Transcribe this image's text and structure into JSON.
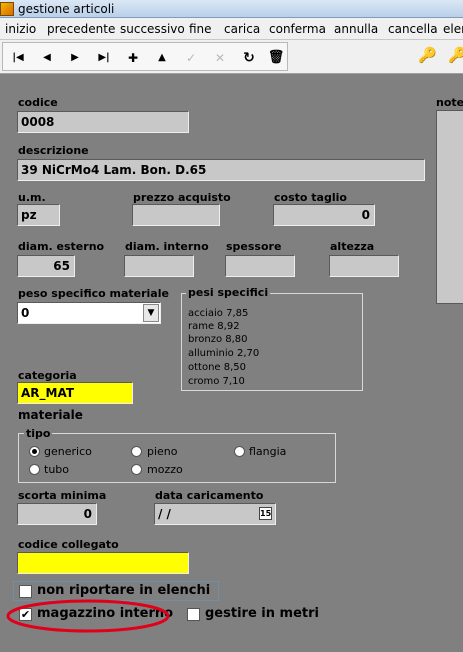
{
  "window": {
    "title": "gestione articoli"
  },
  "menu": [
    "inizio",
    "precedente",
    "successivo",
    "fine",
    "carica",
    "conferma",
    "annulla",
    "cancella",
    "elen"
  ],
  "toolbar": {
    "first": "|◀",
    "prev": "◀",
    "next": "▶",
    "last": "▶|",
    "add": "✚",
    "up": "▲",
    "check": "✓",
    "cancel": "✕",
    "refresh": "↻",
    "trash": "🗑"
  },
  "form": {
    "codice": {
      "label": "codice",
      "value": "0008"
    },
    "descrizione": {
      "label": "descrizione",
      "value": "39 NiCrMo4 Lam. Bon. D.65"
    },
    "um": {
      "label": "u.m.",
      "value": "pz"
    },
    "prezzo_acquisto": {
      "label": "prezzo acquisto",
      "value": ""
    },
    "costo_taglio": {
      "label": "costo taglio",
      "value": "0"
    },
    "diam_esterno": {
      "label": "diam. esterno",
      "value": "65"
    },
    "diam_interno": {
      "label": "diam. interno",
      "value": ""
    },
    "spessore": {
      "label": "spessore",
      "value": ""
    },
    "altezza": {
      "label": "altezza",
      "value": ""
    },
    "peso_specifico": {
      "label": "peso specifico materiale",
      "value": "0"
    },
    "pesi_specifici": {
      "title": "pesi specifici",
      "rows": [
        "acciaio 7,85",
        "rame 8,92",
        "bronzo 8,80",
        "alluminio 2,70",
        "ottone 8,50",
        "cromo 7,10"
      ]
    },
    "categoria": {
      "label": "categoria",
      "value": "AR_MAT"
    },
    "materiale": {
      "label": "materiale"
    },
    "tipo": {
      "title": "tipo",
      "options": [
        "generico",
        "pieno",
        "flangia",
        "tubo",
        "mozzo"
      ],
      "selected": "generico"
    },
    "scorta_minima": {
      "label": "scorta minima",
      "value": "0"
    },
    "data_caricamento": {
      "label": "data caricamento",
      "value": " /  /"
    },
    "codice_collegato": {
      "label": "codice collegato",
      "value": ""
    },
    "non_riportare": {
      "label": "non riportare in elenchi",
      "checked": false
    },
    "magazzino_interno": {
      "label": "magazzino interno",
      "checked": true
    },
    "gestire_in_metri": {
      "label": "gestire in metri",
      "checked": false
    },
    "note": {
      "label": "note"
    }
  },
  "colors": {
    "background": "#808080",
    "highlight": "#ffff00",
    "annotation": "#e0001a"
  }
}
